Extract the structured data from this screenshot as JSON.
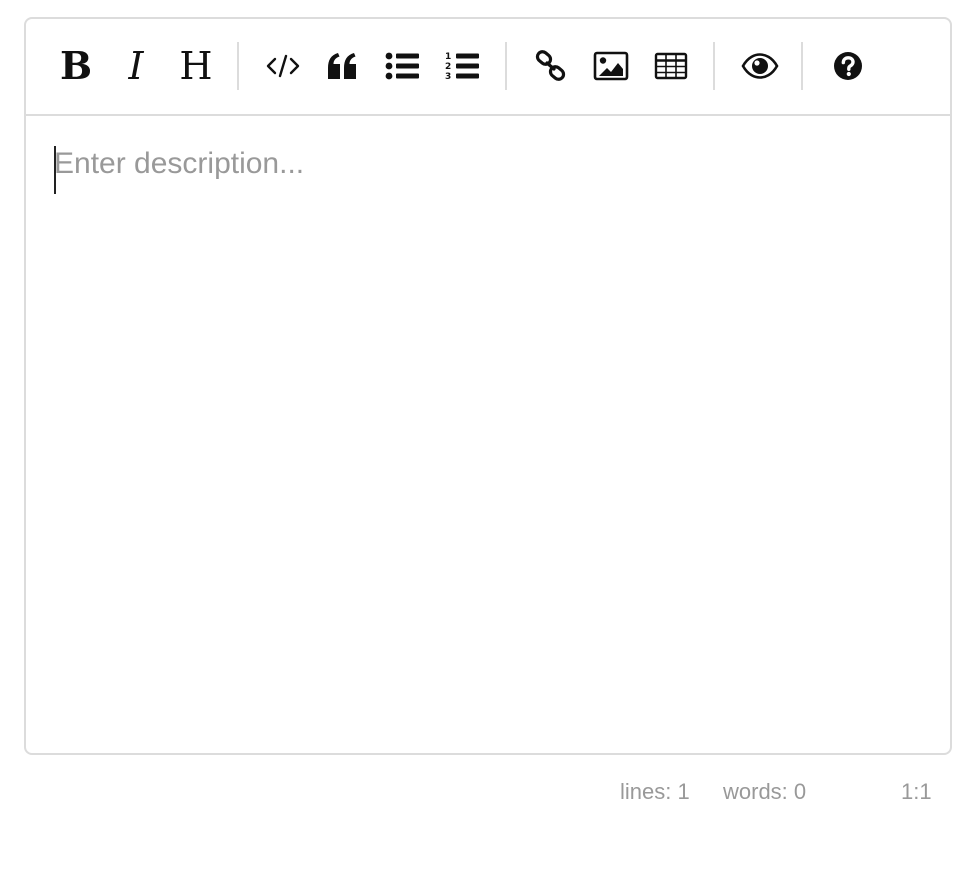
{
  "toolbar": {
    "buttons": [
      {
        "id": "bold",
        "label": "B",
        "icon": "bold-icon"
      },
      {
        "id": "italic",
        "label": "I",
        "icon": "italic-icon"
      },
      {
        "id": "heading",
        "label": "H",
        "icon": "heading-icon"
      },
      {
        "id": "code",
        "icon": "code-icon"
      },
      {
        "id": "quote",
        "icon": "quote-icon"
      },
      {
        "id": "unordered-list",
        "icon": "unordered-list-icon"
      },
      {
        "id": "ordered-list",
        "icon": "ordered-list-icon"
      },
      {
        "id": "link",
        "icon": "link-icon"
      },
      {
        "id": "image",
        "icon": "image-icon"
      },
      {
        "id": "table",
        "icon": "table-icon"
      },
      {
        "id": "preview",
        "icon": "eye-icon"
      },
      {
        "id": "guide",
        "icon": "help-icon"
      }
    ]
  },
  "editor": {
    "value": "",
    "placeholder": "Enter description..."
  },
  "status": {
    "lines": "lines: 1",
    "words": "words: 0",
    "cursor": "1:1"
  },
  "colors": {
    "border": "#dcdcdc",
    "icon": "#111111",
    "placeholder": "#999999",
    "status_text": "#999999"
  }
}
